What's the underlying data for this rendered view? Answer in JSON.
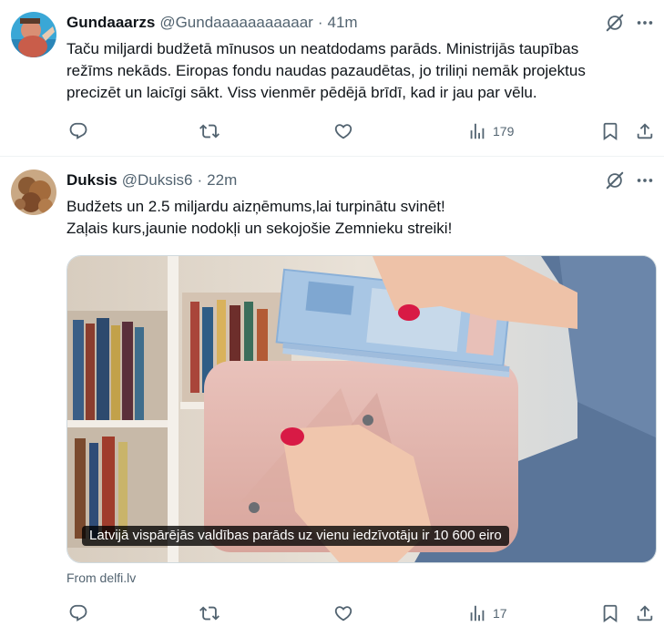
{
  "tweets": [
    {
      "display_name": "Gundaaarzs",
      "handle": "@Gundaaaaaaaaaaar",
      "separator": "·",
      "time": "41m",
      "text_lines": [
        "Taču miljardi budžetā mīnusos un neatdodams parāds. Ministrijās taupības",
        "režīms nekāds. Eiropas fondu naudas pazaudētas, jo triliņi nemāk projektus",
        "precizēt un laicīgi sākt. Viss vienmēr pēdējā brīdī, kad ir jau par vēlu."
      ],
      "views": "179"
    },
    {
      "display_name": "Duksis",
      "handle": "@Duksis6",
      "separator": "·",
      "time": "22m",
      "text_lines": [
        "Budžets un 2.5 miljardu aizņēmums,lai turpinātu svinēt!",
        "Zaļais kurs,jaunie nodokļi un sekojošie Zemnieku streiki!"
      ],
      "card": {
        "caption": "Latvijā vispārējās valdības parāds uz vienu iedzīvotāju ir 10 600 eiro",
        "source": "From delfi.lv"
      },
      "views": "17"
    }
  ],
  "icons": {
    "reply": "reply-icon",
    "retweet": "retweet-icon",
    "like": "like-icon",
    "views": "views-icon",
    "bookmark": "bookmark-icon",
    "share": "share-icon",
    "grok": "grok-icon",
    "more": "more-icon"
  },
  "colors": {
    "text": "#0f1419",
    "secondary": "#536471",
    "divider": "#eff3f4"
  }
}
